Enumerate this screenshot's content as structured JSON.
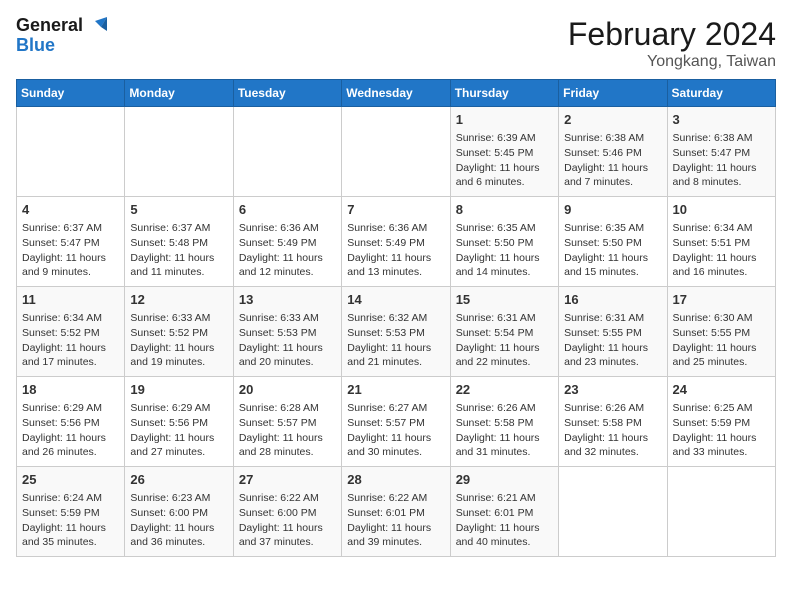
{
  "logo": {
    "line1": "General",
    "line2": "Blue"
  },
  "title": "February 2024",
  "subtitle": "Yongkang, Taiwan",
  "days_of_week": [
    "Sunday",
    "Monday",
    "Tuesday",
    "Wednesday",
    "Thursday",
    "Friday",
    "Saturday"
  ],
  "weeks": [
    [
      {
        "day": "",
        "sunrise": "",
        "sunset": "",
        "daylight": ""
      },
      {
        "day": "",
        "sunrise": "",
        "sunset": "",
        "daylight": ""
      },
      {
        "day": "",
        "sunrise": "",
        "sunset": "",
        "daylight": ""
      },
      {
        "day": "",
        "sunrise": "",
        "sunset": "",
        "daylight": ""
      },
      {
        "day": "1",
        "sunrise": "Sunrise: 6:39 AM",
        "sunset": "Sunset: 5:45 PM",
        "daylight": "Daylight: 11 hours and 6 minutes."
      },
      {
        "day": "2",
        "sunrise": "Sunrise: 6:38 AM",
        "sunset": "Sunset: 5:46 PM",
        "daylight": "Daylight: 11 hours and 7 minutes."
      },
      {
        "day": "3",
        "sunrise": "Sunrise: 6:38 AM",
        "sunset": "Sunset: 5:47 PM",
        "daylight": "Daylight: 11 hours and 8 minutes."
      }
    ],
    [
      {
        "day": "4",
        "sunrise": "Sunrise: 6:37 AM",
        "sunset": "Sunset: 5:47 PM",
        "daylight": "Daylight: 11 hours and 9 minutes."
      },
      {
        "day": "5",
        "sunrise": "Sunrise: 6:37 AM",
        "sunset": "Sunset: 5:48 PM",
        "daylight": "Daylight: 11 hours and 11 minutes."
      },
      {
        "day": "6",
        "sunrise": "Sunrise: 6:36 AM",
        "sunset": "Sunset: 5:49 PM",
        "daylight": "Daylight: 11 hours and 12 minutes."
      },
      {
        "day": "7",
        "sunrise": "Sunrise: 6:36 AM",
        "sunset": "Sunset: 5:49 PM",
        "daylight": "Daylight: 11 hours and 13 minutes."
      },
      {
        "day": "8",
        "sunrise": "Sunrise: 6:35 AM",
        "sunset": "Sunset: 5:50 PM",
        "daylight": "Daylight: 11 hours and 14 minutes."
      },
      {
        "day": "9",
        "sunrise": "Sunrise: 6:35 AM",
        "sunset": "Sunset: 5:50 PM",
        "daylight": "Daylight: 11 hours and 15 minutes."
      },
      {
        "day": "10",
        "sunrise": "Sunrise: 6:34 AM",
        "sunset": "Sunset: 5:51 PM",
        "daylight": "Daylight: 11 hours and 16 minutes."
      }
    ],
    [
      {
        "day": "11",
        "sunrise": "Sunrise: 6:34 AM",
        "sunset": "Sunset: 5:52 PM",
        "daylight": "Daylight: 11 hours and 17 minutes."
      },
      {
        "day": "12",
        "sunrise": "Sunrise: 6:33 AM",
        "sunset": "Sunset: 5:52 PM",
        "daylight": "Daylight: 11 hours and 19 minutes."
      },
      {
        "day": "13",
        "sunrise": "Sunrise: 6:33 AM",
        "sunset": "Sunset: 5:53 PM",
        "daylight": "Daylight: 11 hours and 20 minutes."
      },
      {
        "day": "14",
        "sunrise": "Sunrise: 6:32 AM",
        "sunset": "Sunset: 5:53 PM",
        "daylight": "Daylight: 11 hours and 21 minutes."
      },
      {
        "day": "15",
        "sunrise": "Sunrise: 6:31 AM",
        "sunset": "Sunset: 5:54 PM",
        "daylight": "Daylight: 11 hours and 22 minutes."
      },
      {
        "day": "16",
        "sunrise": "Sunrise: 6:31 AM",
        "sunset": "Sunset: 5:55 PM",
        "daylight": "Daylight: 11 hours and 23 minutes."
      },
      {
        "day": "17",
        "sunrise": "Sunrise: 6:30 AM",
        "sunset": "Sunset: 5:55 PM",
        "daylight": "Daylight: 11 hours and 25 minutes."
      }
    ],
    [
      {
        "day": "18",
        "sunrise": "Sunrise: 6:29 AM",
        "sunset": "Sunset: 5:56 PM",
        "daylight": "Daylight: 11 hours and 26 minutes."
      },
      {
        "day": "19",
        "sunrise": "Sunrise: 6:29 AM",
        "sunset": "Sunset: 5:56 PM",
        "daylight": "Daylight: 11 hours and 27 minutes."
      },
      {
        "day": "20",
        "sunrise": "Sunrise: 6:28 AM",
        "sunset": "Sunset: 5:57 PM",
        "daylight": "Daylight: 11 hours and 28 minutes."
      },
      {
        "day": "21",
        "sunrise": "Sunrise: 6:27 AM",
        "sunset": "Sunset: 5:57 PM",
        "daylight": "Daylight: 11 hours and 30 minutes."
      },
      {
        "day": "22",
        "sunrise": "Sunrise: 6:26 AM",
        "sunset": "Sunset: 5:58 PM",
        "daylight": "Daylight: 11 hours and 31 minutes."
      },
      {
        "day": "23",
        "sunrise": "Sunrise: 6:26 AM",
        "sunset": "Sunset: 5:58 PM",
        "daylight": "Daylight: 11 hours and 32 minutes."
      },
      {
        "day": "24",
        "sunrise": "Sunrise: 6:25 AM",
        "sunset": "Sunset: 5:59 PM",
        "daylight": "Daylight: 11 hours and 33 minutes."
      }
    ],
    [
      {
        "day": "25",
        "sunrise": "Sunrise: 6:24 AM",
        "sunset": "Sunset: 5:59 PM",
        "daylight": "Daylight: 11 hours and 35 minutes."
      },
      {
        "day": "26",
        "sunrise": "Sunrise: 6:23 AM",
        "sunset": "Sunset: 6:00 PM",
        "daylight": "Daylight: 11 hours and 36 minutes."
      },
      {
        "day": "27",
        "sunrise": "Sunrise: 6:22 AM",
        "sunset": "Sunset: 6:00 PM",
        "daylight": "Daylight: 11 hours and 37 minutes."
      },
      {
        "day": "28",
        "sunrise": "Sunrise: 6:22 AM",
        "sunset": "Sunset: 6:01 PM",
        "daylight": "Daylight: 11 hours and 39 minutes."
      },
      {
        "day": "29",
        "sunrise": "Sunrise: 6:21 AM",
        "sunset": "Sunset: 6:01 PM",
        "daylight": "Daylight: 11 hours and 40 minutes."
      },
      {
        "day": "",
        "sunrise": "",
        "sunset": "",
        "daylight": ""
      },
      {
        "day": "",
        "sunrise": "",
        "sunset": "",
        "daylight": ""
      }
    ]
  ]
}
